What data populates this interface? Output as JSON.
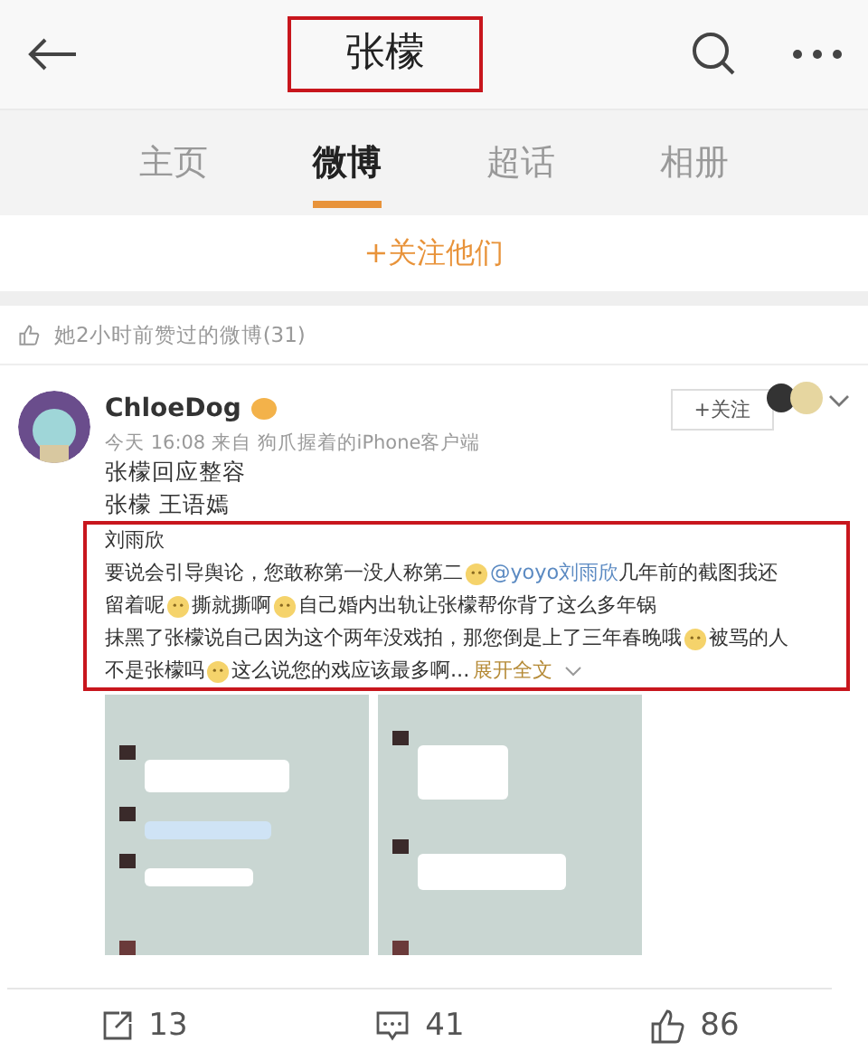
{
  "header": {
    "title": "张檬",
    "highlighted": true
  },
  "tabs": [
    {
      "label": "主页",
      "selected": false
    },
    {
      "label": "微博",
      "selected": true
    },
    {
      "label": "超话",
      "selected": false
    },
    {
      "label": "相册",
      "selected": false
    }
  ],
  "follow_all": "+关注他们",
  "liked_notice": "她2小时前赞过的微博(31)",
  "post": {
    "author": "ChloeDog",
    "meta": "今天 16:08 来自 狗爪握着的iPhone客户端",
    "follow": "+关注",
    "lines": [
      "张檬回应整容",
      "张檬 王语嫣"
    ],
    "quote": {
      "highlighted": true,
      "lines": [
        [
          {
            "kind": "text",
            "text": "刘雨欣"
          }
        ],
        [
          {
            "kind": "text",
            "text": "要说会引导舆论，您敢称第一没人称第二"
          },
          {
            "kind": "emoji"
          },
          {
            "kind": "mention",
            "text": "@yoyo刘雨欣"
          },
          {
            "kind": "text",
            "text": " 几年前的截图我还"
          }
        ],
        [
          {
            "kind": "text",
            "text": "留着呢"
          },
          {
            "kind": "emoji"
          },
          {
            "kind": "text",
            "text": "撕就撕啊"
          },
          {
            "kind": "emoji"
          },
          {
            "kind": "text",
            "text": "自己婚内出轨让张檬帮你背了这么多年锅"
          }
        ],
        [
          {
            "kind": "text",
            "text": "抹黑了张檬说自己因为这个两年没戏拍，那您倒是上了三年春晚哦"
          },
          {
            "kind": "emoji"
          },
          {
            "kind": "text",
            "text": "被骂的人"
          }
        ],
        [
          {
            "kind": "text",
            "text": "不是张檬吗"
          },
          {
            "kind": "emoji"
          },
          {
            "kind": "text",
            "text": "这么说您的戏应该最多啊"
          },
          {
            "kind": "text",
            "text": " ... "
          },
          {
            "kind": "more",
            "text": "展开全文"
          }
        ]
      ]
    },
    "images": [
      {
        "kind": "picture"
      },
      {
        "kind": "picture"
      }
    ],
    "actions": [
      {
        "kind": "repost",
        "count": "13"
      },
      {
        "kind": "comment",
        "count": "41"
      },
      {
        "kind": "like",
        "count": "86"
      }
    ]
  }
}
